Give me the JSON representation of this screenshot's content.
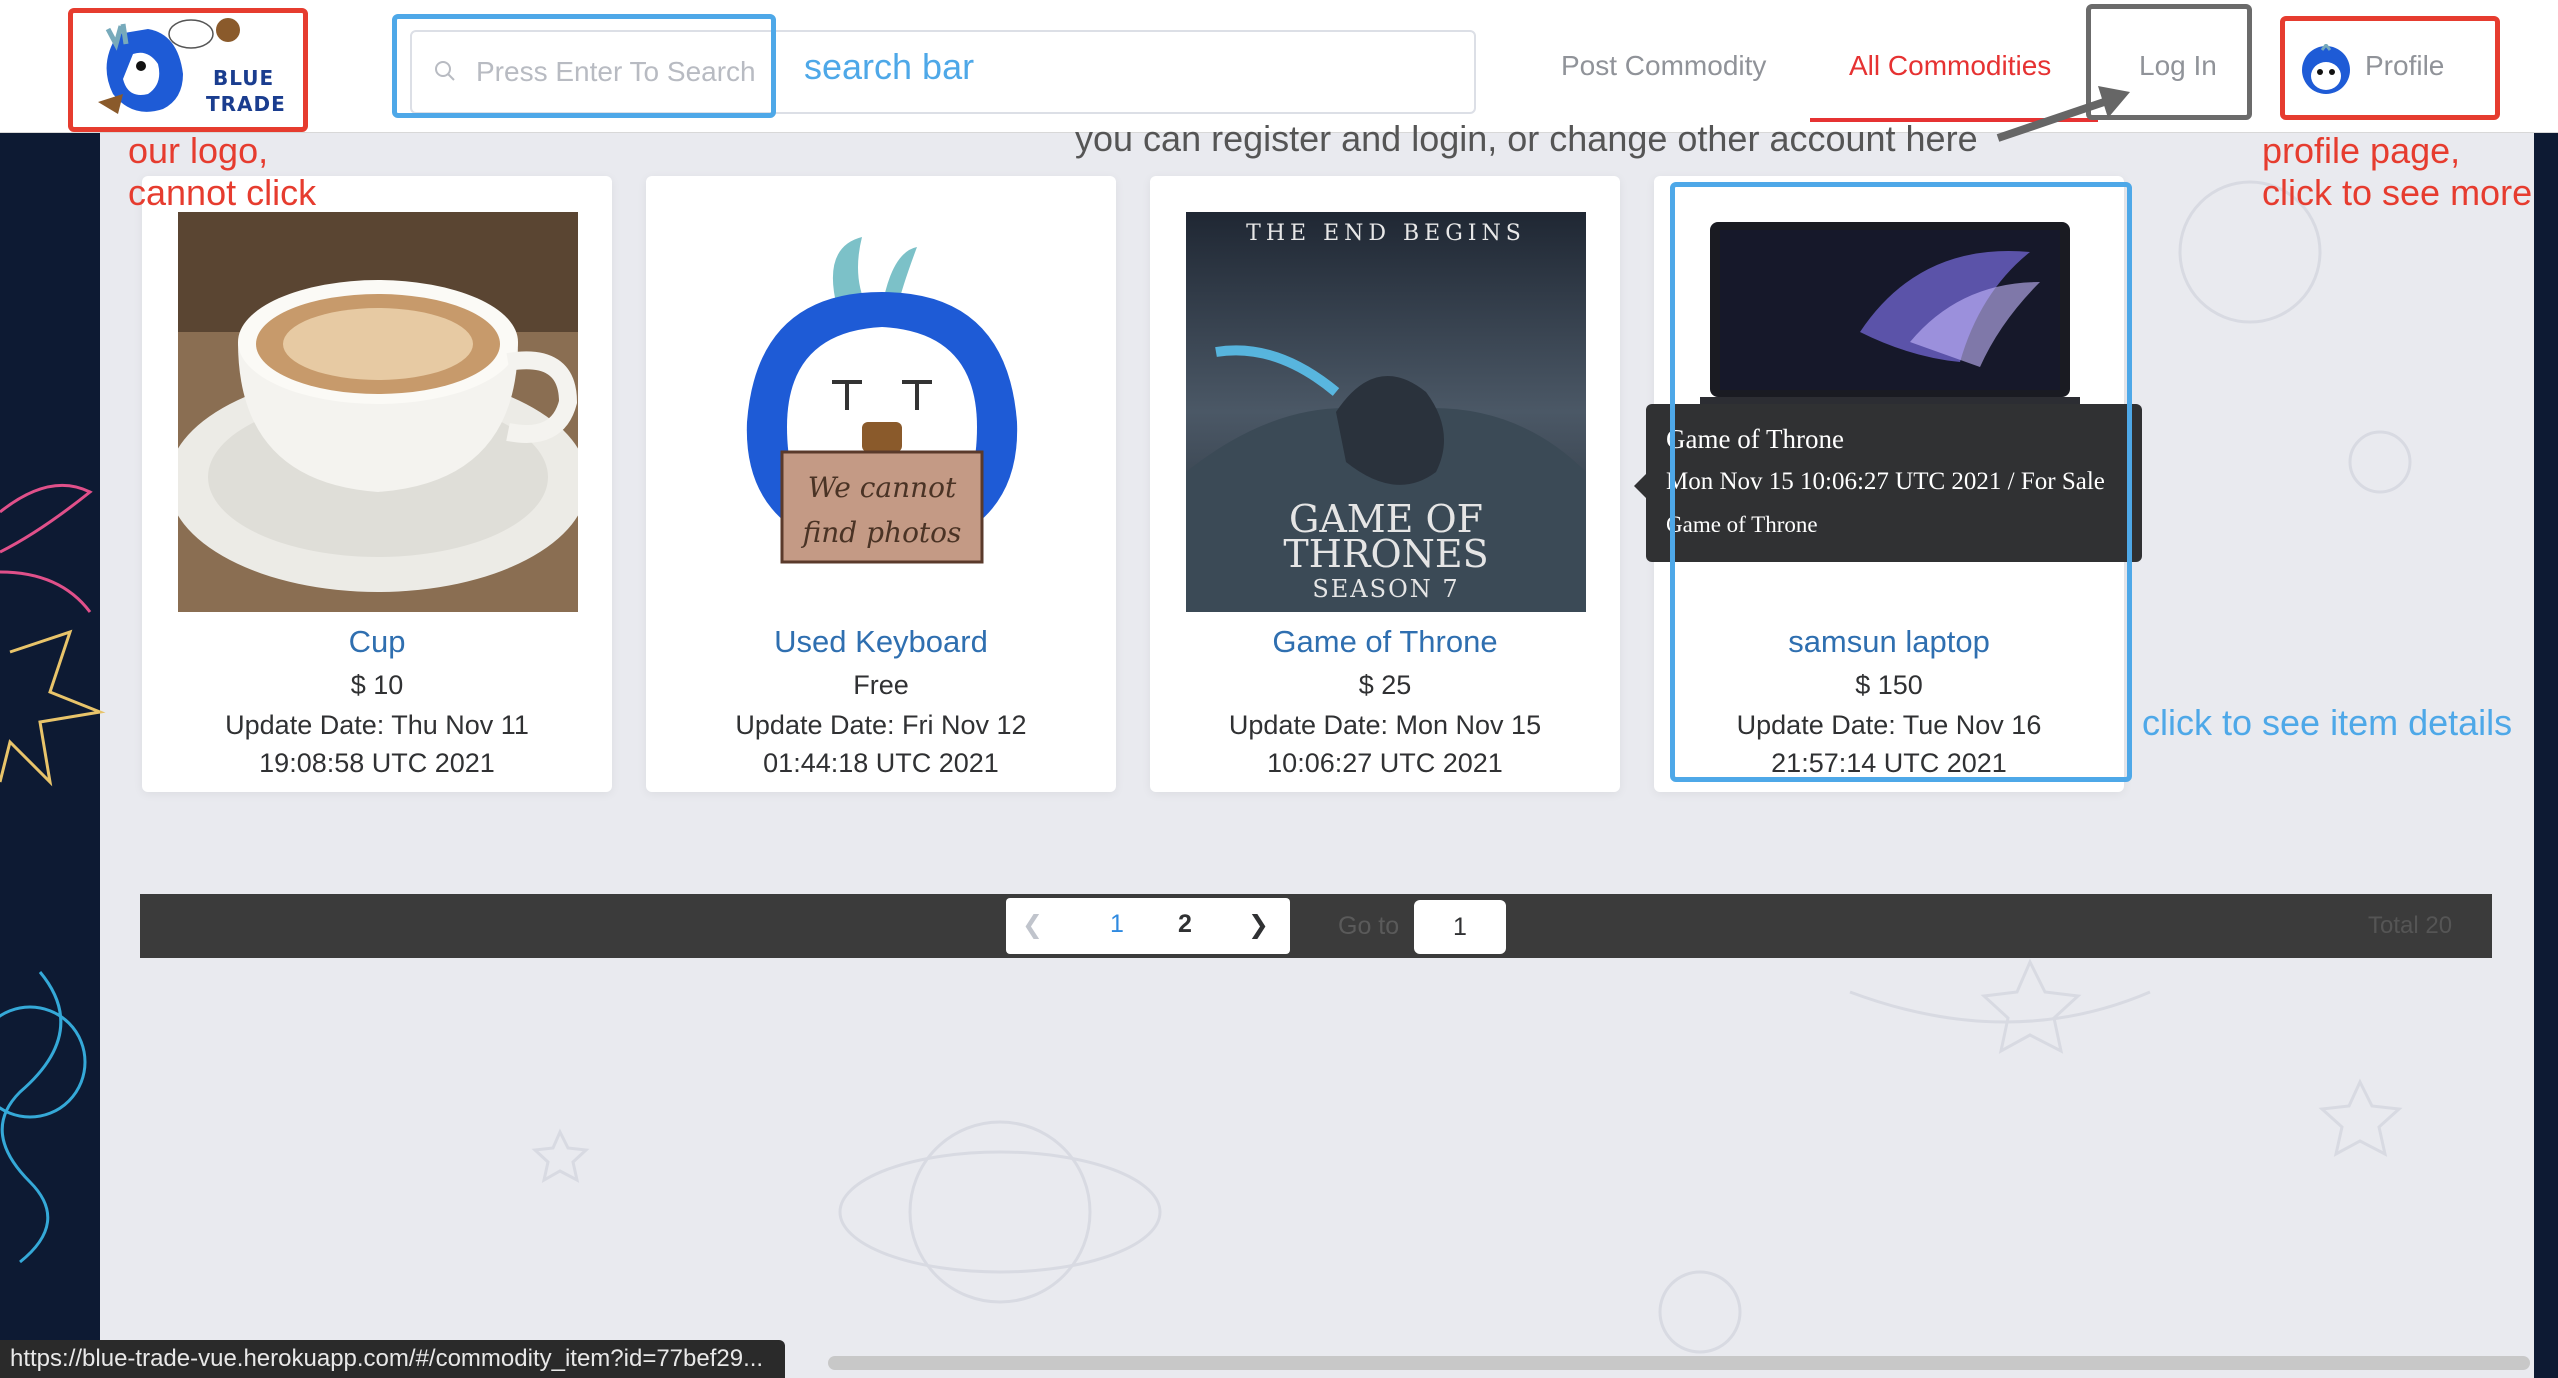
{
  "header": {
    "logo_line1": "BLUE",
    "logo_line2": "TRADE",
    "search_placeholder": "Press Enter To Search",
    "nav": {
      "post": "Post Commodity",
      "all": "All Commodities",
      "login": "Log In",
      "profile": "Profile"
    }
  },
  "annotations": {
    "logo": "our logo,\ncannot click",
    "search": "search bar",
    "login": "you can register and login, or change other account here",
    "profile": "profile page,\nclick to see more",
    "item": "click to see item details"
  },
  "products": [
    {
      "name": "Cup",
      "price": "$ 10",
      "date": "Update Date: Thu Nov 11 19:08:58 UTC 2021",
      "image": "coffee-cup"
    },
    {
      "name": "Used Keyboard",
      "price": "Free",
      "date": "Update Date: Fri Nov 12 01:44:18 UTC 2021",
      "image": "placeholder-mascot",
      "image_text": "We cannot find photos"
    },
    {
      "name": "Game of Throne",
      "price": "$ 25",
      "date": "Update Date: Mon Nov 15 10:06:27 UTC 2021",
      "image": "got-poster",
      "image_top": "THE END BEGINS",
      "image_title1": "GAME OF",
      "image_title2": "THRONES",
      "image_title3": "SEASON 7"
    },
    {
      "name": "samsun laptop",
      "price": "$ 150",
      "date": "Update Date: Tue Nov 16 21:57:14 UTC 2021",
      "image": "laptop"
    }
  ],
  "tooltip": {
    "title": "Game of Throne",
    "meta": "Mon Nov 15 10:06:27 UTC 2021 / For Sale",
    "desc": "Game of Throne"
  },
  "pagination": {
    "pages": [
      "1",
      "2"
    ],
    "current": "1",
    "goto_label": "Go to",
    "goto_value": "1",
    "total": "Total 20"
  },
  "status_url": "https://blue-trade-vue.herokuapp.com/#/commodity_item?id=77bef29..."
}
